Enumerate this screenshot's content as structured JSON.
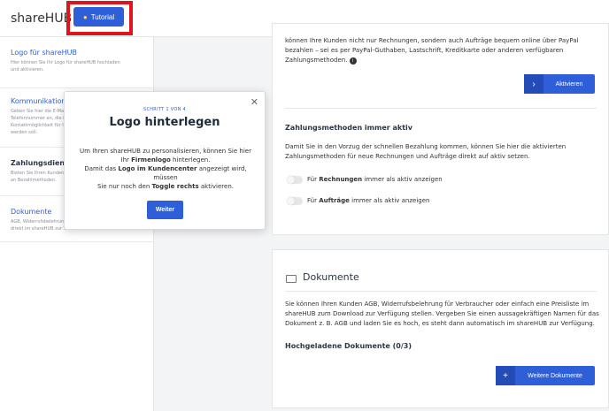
{
  "header": {
    "brand": "shareHUB",
    "tutorial_label": "Tutorial",
    "tutorial_icon": "lightbulb-icon"
  },
  "sidebar": {
    "items": [
      {
        "title": "Logo für shareHUB",
        "desc": [
          "Hier können Sie Ihr Logo für shareHUB hochladen",
          "und aktivieren."
        ]
      },
      {
        "title": "Kommunikation",
        "desc": [
          "Geben Sie hier die E-Mail",
          "Telefonnummer an, die i",
          "Kontaktmöglichkeit für I",
          "werden soll."
        ]
      },
      {
        "title": "Zahlungsdienstan",
        "desc": [
          "Bieten Sie Ihren Kunden",
          "an Bezahlmethoden."
        ]
      },
      {
        "title": "Dokumente",
        "desc": [
          "AGB, Widerrufsbelehrung",
          "direkt im shareHUB zur V"
        ]
      }
    ]
  },
  "payment": {
    "intro": [
      "können Ihre Kunden nicht nur Rechnungen, sondern auch Aufträge bequem online über PayPal",
      "bezahlen – sei es per PayPal-Guthaben, Lastschrift, Kreditkarte oder anderen verfügbaren",
      "Zahlungsmethoden."
    ],
    "activate_label": "Aktivieren",
    "always_title": "Zahlungsmethoden immer aktiv",
    "always_text": [
      "Damit Sie in den Vorzug der schnellen Bezahlung kommen, können Sie hier die aktivierten",
      "Zahlungsmethoden für neue Rechnungen und Aufträge direkt auf aktiv setzen."
    ],
    "toggles": [
      {
        "pre": "Für ",
        "bold": "Rechnungen",
        "post": " immer als aktiv anzeigen"
      },
      {
        "pre": "Für ",
        "bold": "Aufträge",
        "post": " immer als aktiv anzeigen"
      }
    ]
  },
  "documents": {
    "title": "Dokumente",
    "text": [
      "Sie können Ihren Kunden AGB, Widerrufsbelehrung für Verbraucher oder einfach eine Preisliste im",
      "shareHUB zum Download zur Verfügung stellen. Vergeben Sie einen aussagekräftigen Namen für das",
      "Dokument z. B. AGB und laden Sie es hoch, es steht dann automatisch im shareHUB zur Verfügung."
    ],
    "uploaded_label": "Hochgeladene Dokumente (0/3)",
    "more_label": "Weitere Dokumente"
  },
  "popover": {
    "step": "SCHRITT 1 VON 4",
    "title": "Logo hinterlegen",
    "line1": "Um Ihren shareHUB zu personalisieren, können Sie hier",
    "line2_pre": "Ihr ",
    "line2_bold": "Firmenlogo",
    "line2_post": " hinterlegen.",
    "line3_pre": "Damit das ",
    "line3_bold": "Logo im Kundencenter",
    "line3_post": " angezeigt wird, müssen",
    "line4_pre": "Sie nur noch den ",
    "line4_bold": "Toggle rechts",
    "line4_post": " aktivieren.",
    "next_label": "Weiter",
    "close_glyph": "✕"
  },
  "colors": {
    "accent": "#2f5fd8",
    "highlight": "#e0141e"
  }
}
